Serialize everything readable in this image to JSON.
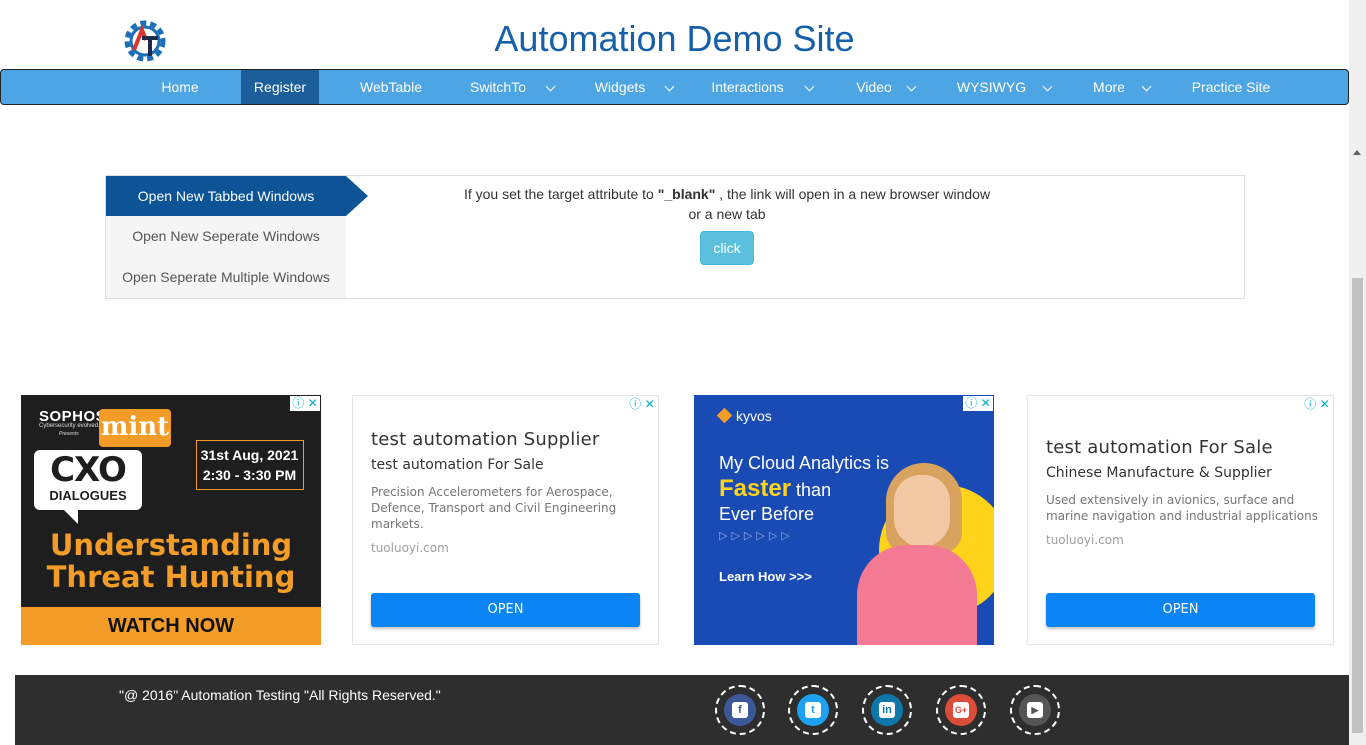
{
  "header": {
    "title": "Automation Demo Site",
    "logo_icon": "automation-gear-logo-icon"
  },
  "nav": {
    "items": [
      {
        "label": "Home",
        "has_dropdown": false,
        "active": false
      },
      {
        "label": "Register",
        "has_dropdown": false,
        "active": true
      },
      {
        "label": "WebTable",
        "has_dropdown": false,
        "active": false
      },
      {
        "label": "SwitchTo",
        "has_dropdown": true,
        "active": false
      },
      {
        "label": "Widgets",
        "has_dropdown": true,
        "active": false
      },
      {
        "label": "Interactions",
        "has_dropdown": true,
        "active": false
      },
      {
        "label": "Video",
        "has_dropdown": true,
        "active": false
      },
      {
        "label": "WYSIWYG",
        "has_dropdown": true,
        "active": false
      },
      {
        "label": "More",
        "has_dropdown": true,
        "active": false
      },
      {
        "label": "Practice Site",
        "has_dropdown": false,
        "active": false
      }
    ]
  },
  "windows": {
    "tabs": [
      {
        "label": "Open New Tabbed Windows",
        "active": true
      },
      {
        "label": "Open New Seperate Windows",
        "active": false
      },
      {
        "label": "Open Seperate Multiple Windows",
        "active": false
      }
    ],
    "text_before": "If you set the target attribute to ",
    "text_bold": "\"_blank\"",
    "text_after": " , the link will open in a new browser window",
    "text_line2": "or a new tab",
    "click_label": "click"
  },
  "ads": {
    "sophos": {
      "brand": "SOPHOS",
      "brand_sub": "Cybersecurity evolved.",
      "presents": "Presents",
      "mint": "mint",
      "cxo": "CXO",
      "dialogues": "DIALOGUES",
      "date": "31st Aug, 2021",
      "time": "2:30 - 3:30  PM",
      "headline1": "Understanding",
      "headline2": "Threat Hunting",
      "cta": "WATCH NOW"
    },
    "text1": {
      "title": "test automation Supplier",
      "subtitle": "test automation For Sale",
      "description": "Precision Accelerometers for Aerospace, Defence, Transport and Civil Engineering markets.",
      "domain": "tuoluoyi.com",
      "button": "OPEN"
    },
    "kyvos": {
      "brand": "kyvos",
      "line1": "My Cloud Analytics is",
      "faster": "Faster",
      "than": " than",
      "line3": "Ever Before",
      "dots": "▷▷▷▷▷▷",
      "cta": "Learn How >>>"
    },
    "text2": {
      "title": "test automation For Sale",
      "subtitle": "Chinese Manufacture & Supplier",
      "description": "Used extensively in avionics, surface and marine navigation and industrial applications",
      "domain": "tuoluoyi.com",
      "button": "OPEN"
    },
    "info_icon": "ⓘ",
    "close_icon": "✕"
  },
  "footer": {
    "copyright": "\"@ 2016\" Automation Testing \"All Rights Reserved.\"",
    "social": [
      {
        "name": "facebook-icon",
        "color": "#3b5998",
        "glyph": "f"
      },
      {
        "name": "twitter-icon",
        "color": "#1da1f2",
        "glyph": "t"
      },
      {
        "name": "linkedin-icon",
        "color": "#0e76a8",
        "glyph": "in"
      },
      {
        "name": "google-plus-icon",
        "color": "#dd4b39",
        "glyph": "G+"
      },
      {
        "name": "youtube-icon",
        "color": "#555555",
        "glyph": "▶"
      }
    ]
  }
}
